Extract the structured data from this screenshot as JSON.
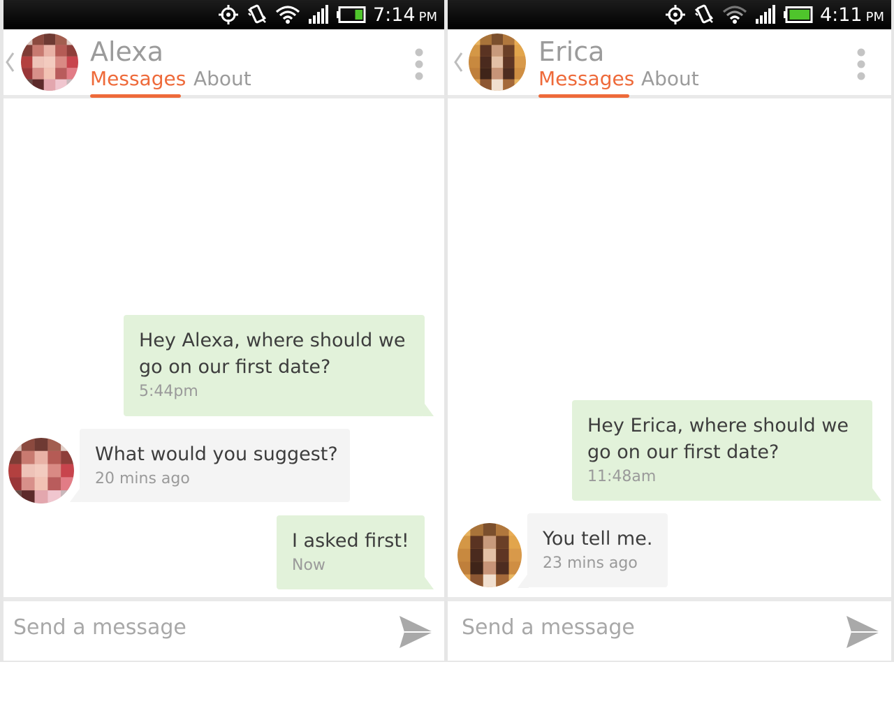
{
  "icons": [
    "gps-icon",
    "vibrate-icon",
    "wifi-icon",
    "signal-icon",
    "battery-icon",
    "back-chevron-icon",
    "more-vert-icon",
    "send-icon"
  ],
  "colors": {
    "accent": "#ee6a3a",
    "outgoing_bubble": "#e2f2da",
    "incoming_bubble": "#f4f4f4",
    "status_bar": "#000000",
    "battery_fill": "#4fc52c"
  },
  "left": {
    "status": {
      "time": "7:14",
      "ampm": "PM",
      "battery_level": 0.35
    },
    "header": {
      "name": "Alexa",
      "tab_messages": "Messages",
      "tab_about": "About"
    },
    "messages": [
      {
        "from": "me",
        "text_lines": [
          "Hey Alexa, where should we",
          "go on our first date?"
        ],
        "time": "5:44pm"
      },
      {
        "from": "them",
        "text_lines": [
          "What would you suggest?"
        ],
        "time": "20 mins ago"
      },
      {
        "from": "me",
        "text_lines": [
          "I asked first!"
        ],
        "time": "Now"
      }
    ],
    "composer": {
      "placeholder": "Send a message"
    }
  },
  "right": {
    "status": {
      "time": "4:11",
      "ampm": "PM",
      "battery_level": 0.95
    },
    "header": {
      "name": "Erica",
      "tab_messages": "Messages",
      "tab_about": "About"
    },
    "messages": [
      {
        "from": "me",
        "text_lines": [
          "Hey Erica, where should we",
          "go on our first date?"
        ],
        "time": "11:48am"
      },
      {
        "from": "them",
        "text_lines": [
          "You tell me."
        ],
        "time": "23 mins ago"
      }
    ],
    "composer": {
      "placeholder": "Send a message"
    }
  }
}
